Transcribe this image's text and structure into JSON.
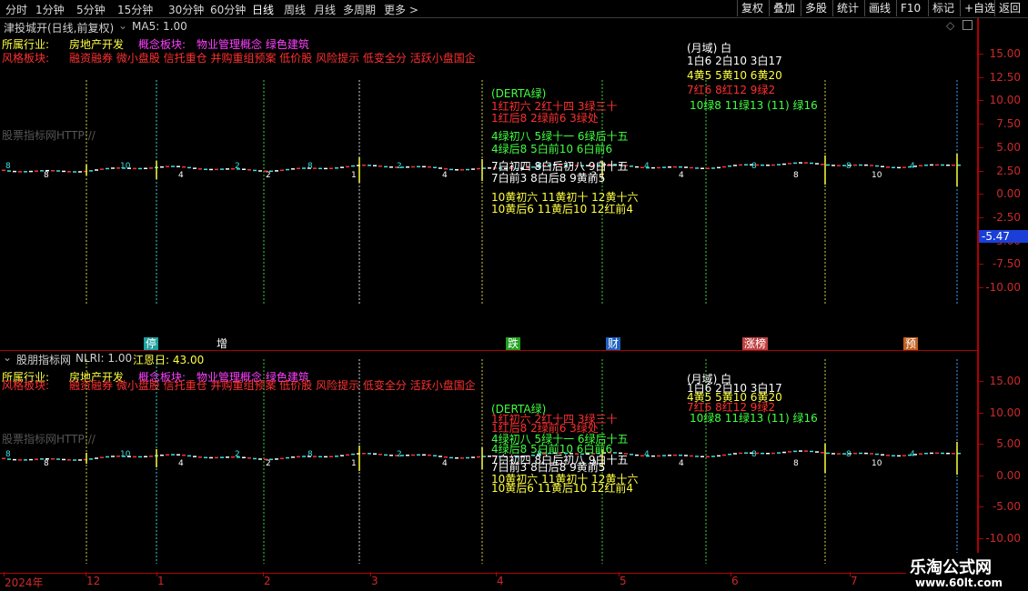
{
  "toolbar": {
    "periods": [
      "分时",
      "1分钟",
      "5分钟",
      "15分钟",
      "30分钟",
      "60分钟",
      "日线",
      "周线",
      "月线",
      "多周期",
      "更多 >"
    ],
    "active_period": "日线",
    "right_buttons": [
      "复权",
      "叠加",
      "多股",
      "统计",
      "画线",
      "F10",
      "标记",
      "+自选",
      "返回"
    ]
  },
  "top_panel": {
    "title": "津投城开(日线,前复权)",
    "indicator": "MA5: 1.00",
    "industry_label": "所属行业:",
    "industry_value": "房地产开发",
    "concept_label": "概念板块:",
    "concept_value": "物业管理概念 绿色建筑",
    "style_label": "风格板块:",
    "style_value": "融资融券 微小盘股 信托重仓 并购重组预案 低价股 风险提示 低变全分 活跃小盘国企",
    "watermark_text": "股票指标网HTTP://",
    "axis": [
      "15.00",
      "12.50",
      "10.00",
      "7.50",
      "5.00",
      "2.50",
      "0.00",
      "-2.50",
      "-5.00",
      "-7.50",
      "-10.00"
    ],
    "current_value": "-5.47",
    "markers": [
      "停",
      "增",
      "跌",
      "财",
      "涨榜",
      "预"
    ]
  },
  "bottom_panel": {
    "title": "股朋指标网",
    "indicator": "NLRI: 1.00",
    "indicator2": "江恩日: 43.00",
    "industry_label": "所属行业:",
    "industry_value": "房地产开发",
    "concept_label": "概念板块:",
    "concept_value": "物业管理概念 绿色建筑",
    "style_label": "风格板块:",
    "style_value": "融资融券 微小盘股 信托重仓 并购重组预案 低价股 风险提示 低变全分 活跃小盘国企",
    "watermark_text": "股票指标网HTTP://",
    "axis": [
      "15.00",
      "10.00",
      "5.00",
      "0.00",
      "-5.00",
      "-10.00"
    ]
  },
  "annotations": {
    "month_header": "(月域) 白",
    "row1": "1白6   2白10   3白17",
    "row2": "4黄5   5黄10   6黄20",
    "row3": "7红6   8红12   9绿2",
    "row4": "10绿8  11绿13  (11) 绿16",
    "derta": "(DERTA绿)",
    "derta_r1": "1红初六    2红十四    3绿三十",
    "derta_r2": "1红后8    2绿前6    3绿处",
    "derta_g1": "4绿初八    5绿十一    6绿后十五",
    "derta_g2": "4绿后8    5白前10    6白前6",
    "derta_w1": "7白初四    8白后初八    9白十五",
    "derta_w2": "7白前3    8白后8    9黄前5",
    "derta_y1": "10黄初六  11黄初十  12黄十六",
    "derta_y2": "10黄后6  11黄后10  12红前4"
  },
  "bar_labels_top": [
    "8",
    "8",
    "10",
    "4",
    "2",
    "2",
    "8",
    "1",
    "2",
    "4",
    "8",
    "2",
    "4",
    "4",
    "8"
  ],
  "date_axis": [
    "2024年",
    "12",
    "1",
    "2",
    "3",
    "4",
    "5",
    "6",
    "7"
  ],
  "watermark": {
    "title": "乐淘公式网",
    "url": "www.60lt.com"
  },
  "colors": {
    "red": "#ff2020",
    "axis": "#cc2a2a",
    "cyan": "#40e0e0",
    "yellow": "#ffff40",
    "green": "#40ff40",
    "magenta": "#ff40ff"
  }
}
